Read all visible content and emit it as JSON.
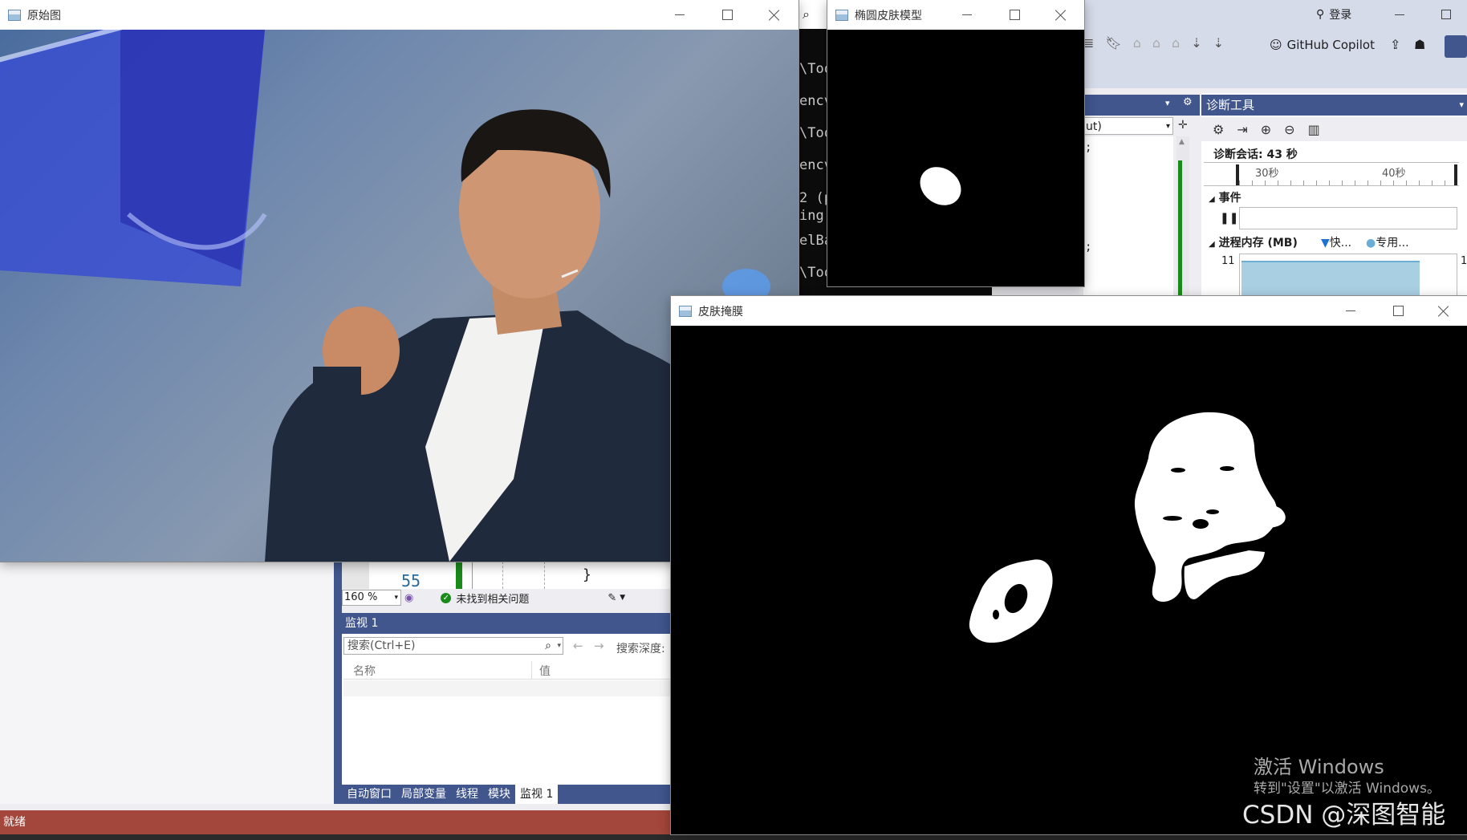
{
  "windows": {
    "original": {
      "title": "原始图"
    },
    "ellipse": {
      "title": "椭圆皮肤模型"
    },
    "mask": {
      "title": "皮肤掩膜"
    }
  },
  "vs": {
    "login": "登录",
    "copilot": "GitHub Copilot",
    "diag_title": "诊断工具",
    "diag_session": "诊断会话: 43 秒",
    "timeline_30": "30秒",
    "timeline_40": "40秒",
    "events_label": "事件",
    "memory_label": "进程内存 (MB)",
    "legend_fast": "快...",
    "legend_private": "专用...",
    "mem_value_left": "11",
    "mem_value_right": "1",
    "output_combo": "ut)",
    "console_lines": [
      "\\Too",
      "encv",
      "\\Too",
      "encv",
      "2 (p",
      "ing",
      "elBa",
      "\\Too"
    ],
    "code_line_number": "55",
    "code_brace": "}",
    "zoom": "160 %",
    "no_issues": "未找到相关问题",
    "watch_title": "监视 1",
    "watch_search_placeholder": "搜索(Ctrl+E)",
    "search_depth": "搜索深度:",
    "col_name": "名称",
    "col_value": "值",
    "bottom_tabs": [
      "自动窗口",
      "局部变量",
      "线程",
      "模块",
      "监视 1"
    ],
    "status": "就绪"
  },
  "overlay": {
    "activate_title": "激活 Windows",
    "activate_sub": "转到\"设置\"以激活 Windows。",
    "watermark": "CSDN @深图智能"
  },
  "colors": {
    "vs_blue": "#40568d",
    "status_red": "#a3463b",
    "accent_green": "#1a8a1a"
  }
}
